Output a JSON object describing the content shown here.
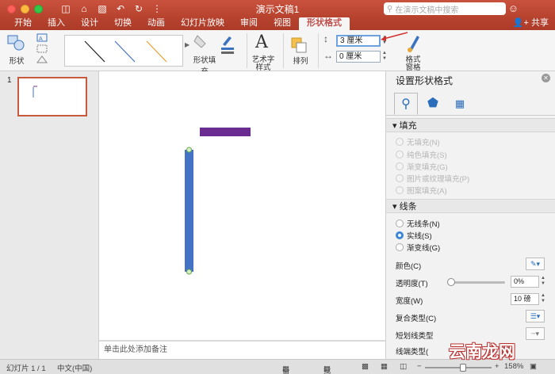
{
  "window": {
    "title": "演示文稿1",
    "search_placeholder": "在演示文稿中搜索"
  },
  "tabs": [
    {
      "label": "开始"
    },
    {
      "label": "插入"
    },
    {
      "label": "设计"
    },
    {
      "label": "切换"
    },
    {
      "label": "动画"
    },
    {
      "label": "幻灯片放映"
    },
    {
      "label": "审阅"
    },
    {
      "label": "视图"
    },
    {
      "label": "形状格式",
      "active": true
    }
  ],
  "share_label": "共享",
  "ribbon": {
    "shapes_label": "形状",
    "shape_fill_label": "形状填充",
    "wordart_label_1": "艺术字",
    "wordart_label_2": "样式",
    "arrange_label": "排列",
    "format_pane_label_1": "格式",
    "format_pane_label_2": "窗格",
    "height_value": "3 厘米",
    "width_value": "0 厘米",
    "accent_arrow_color": "#d0312d"
  },
  "thumbnails": {
    "slide_number": "1"
  },
  "notes_placeholder": "单击此处添加备注",
  "format_pane": {
    "title": "设置形状格式",
    "tabs": [
      "fill-line-icon",
      "effects-pentagon-icon",
      "size-properties-icon"
    ],
    "fill_section": {
      "header": "填充",
      "options": [
        "无填充(N)",
        "纯色填充(S)",
        "渐变填充(G)",
        "图片或纹理填充(P)",
        "图案填充(A)"
      ]
    },
    "line_section": {
      "header": "线条",
      "options": [
        "无线条(N)",
        "实线(S)",
        "渐变线(G)"
      ],
      "selected": "实线(S)",
      "color_label": "颜色(C)",
      "transparency_label": "透明度(T)",
      "transparency_value": "0%",
      "transparency_level": 0,
      "width_label": "宽度(W)",
      "width_value": "10 磅",
      "compound_label": "复合类型(C)",
      "dash_label": "短划线类型",
      "cap_label": "线端类型("
    }
  },
  "slide": {
    "purple_bar_color": "#6b2c91",
    "blue_line_color": "#4472c4"
  },
  "status": {
    "slide_info": "幻灯片 1 / 1",
    "language": "中文(中国)",
    "notes_label": "备注",
    "comments_label": "批注",
    "zoom_value": "158%"
  },
  "watermark": "云南龙网"
}
